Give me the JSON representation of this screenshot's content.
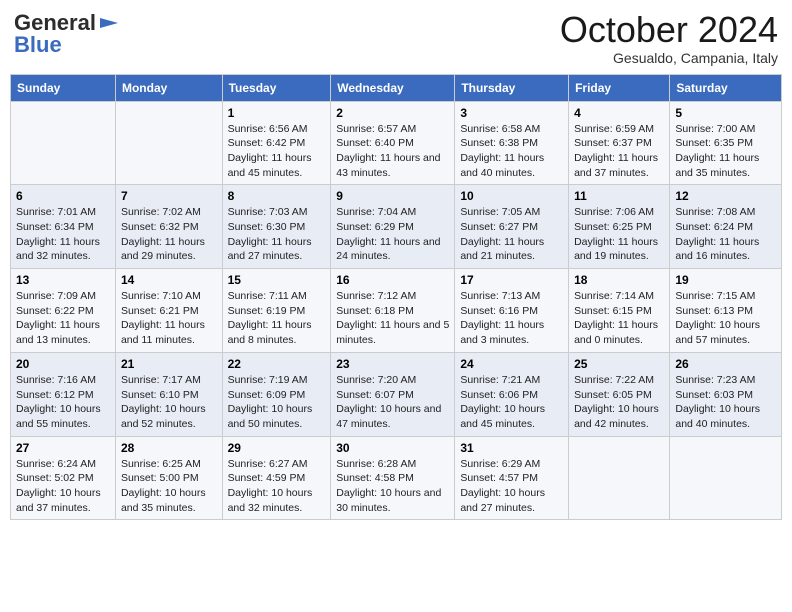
{
  "header": {
    "logo_general": "General",
    "logo_blue": "Blue",
    "month_title": "October 2024",
    "location": "Gesualdo, Campania, Italy"
  },
  "days_of_week": [
    "Sunday",
    "Monday",
    "Tuesday",
    "Wednesday",
    "Thursday",
    "Friday",
    "Saturday"
  ],
  "weeks": [
    [
      {
        "day": "",
        "content": ""
      },
      {
        "day": "",
        "content": ""
      },
      {
        "day": "1",
        "content": "Sunrise: 6:56 AM\nSunset: 6:42 PM\nDaylight: 11 hours and 45 minutes."
      },
      {
        "day": "2",
        "content": "Sunrise: 6:57 AM\nSunset: 6:40 PM\nDaylight: 11 hours and 43 minutes."
      },
      {
        "day": "3",
        "content": "Sunrise: 6:58 AM\nSunset: 6:38 PM\nDaylight: 11 hours and 40 minutes."
      },
      {
        "day": "4",
        "content": "Sunrise: 6:59 AM\nSunset: 6:37 PM\nDaylight: 11 hours and 37 minutes."
      },
      {
        "day": "5",
        "content": "Sunrise: 7:00 AM\nSunset: 6:35 PM\nDaylight: 11 hours and 35 minutes."
      }
    ],
    [
      {
        "day": "6",
        "content": "Sunrise: 7:01 AM\nSunset: 6:34 PM\nDaylight: 11 hours and 32 minutes."
      },
      {
        "day": "7",
        "content": "Sunrise: 7:02 AM\nSunset: 6:32 PM\nDaylight: 11 hours and 29 minutes."
      },
      {
        "day": "8",
        "content": "Sunrise: 7:03 AM\nSunset: 6:30 PM\nDaylight: 11 hours and 27 minutes."
      },
      {
        "day": "9",
        "content": "Sunrise: 7:04 AM\nSunset: 6:29 PM\nDaylight: 11 hours and 24 minutes."
      },
      {
        "day": "10",
        "content": "Sunrise: 7:05 AM\nSunset: 6:27 PM\nDaylight: 11 hours and 21 minutes."
      },
      {
        "day": "11",
        "content": "Sunrise: 7:06 AM\nSunset: 6:25 PM\nDaylight: 11 hours and 19 minutes."
      },
      {
        "day": "12",
        "content": "Sunrise: 7:08 AM\nSunset: 6:24 PM\nDaylight: 11 hours and 16 minutes."
      }
    ],
    [
      {
        "day": "13",
        "content": "Sunrise: 7:09 AM\nSunset: 6:22 PM\nDaylight: 11 hours and 13 minutes."
      },
      {
        "day": "14",
        "content": "Sunrise: 7:10 AM\nSunset: 6:21 PM\nDaylight: 11 hours and 11 minutes."
      },
      {
        "day": "15",
        "content": "Sunrise: 7:11 AM\nSunset: 6:19 PM\nDaylight: 11 hours and 8 minutes."
      },
      {
        "day": "16",
        "content": "Sunrise: 7:12 AM\nSunset: 6:18 PM\nDaylight: 11 hours and 5 minutes."
      },
      {
        "day": "17",
        "content": "Sunrise: 7:13 AM\nSunset: 6:16 PM\nDaylight: 11 hours and 3 minutes."
      },
      {
        "day": "18",
        "content": "Sunrise: 7:14 AM\nSunset: 6:15 PM\nDaylight: 11 hours and 0 minutes."
      },
      {
        "day": "19",
        "content": "Sunrise: 7:15 AM\nSunset: 6:13 PM\nDaylight: 10 hours and 57 minutes."
      }
    ],
    [
      {
        "day": "20",
        "content": "Sunrise: 7:16 AM\nSunset: 6:12 PM\nDaylight: 10 hours and 55 minutes."
      },
      {
        "day": "21",
        "content": "Sunrise: 7:17 AM\nSunset: 6:10 PM\nDaylight: 10 hours and 52 minutes."
      },
      {
        "day": "22",
        "content": "Sunrise: 7:19 AM\nSunset: 6:09 PM\nDaylight: 10 hours and 50 minutes."
      },
      {
        "day": "23",
        "content": "Sunrise: 7:20 AM\nSunset: 6:07 PM\nDaylight: 10 hours and 47 minutes."
      },
      {
        "day": "24",
        "content": "Sunrise: 7:21 AM\nSunset: 6:06 PM\nDaylight: 10 hours and 45 minutes."
      },
      {
        "day": "25",
        "content": "Sunrise: 7:22 AM\nSunset: 6:05 PM\nDaylight: 10 hours and 42 minutes."
      },
      {
        "day": "26",
        "content": "Sunrise: 7:23 AM\nSunset: 6:03 PM\nDaylight: 10 hours and 40 minutes."
      }
    ],
    [
      {
        "day": "27",
        "content": "Sunrise: 6:24 AM\nSunset: 5:02 PM\nDaylight: 10 hours and 37 minutes."
      },
      {
        "day": "28",
        "content": "Sunrise: 6:25 AM\nSunset: 5:00 PM\nDaylight: 10 hours and 35 minutes."
      },
      {
        "day": "29",
        "content": "Sunrise: 6:27 AM\nSunset: 4:59 PM\nDaylight: 10 hours and 32 minutes."
      },
      {
        "day": "30",
        "content": "Sunrise: 6:28 AM\nSunset: 4:58 PM\nDaylight: 10 hours and 30 minutes."
      },
      {
        "day": "31",
        "content": "Sunrise: 6:29 AM\nSunset: 4:57 PM\nDaylight: 10 hours and 27 minutes."
      },
      {
        "day": "",
        "content": ""
      },
      {
        "day": "",
        "content": ""
      }
    ]
  ]
}
